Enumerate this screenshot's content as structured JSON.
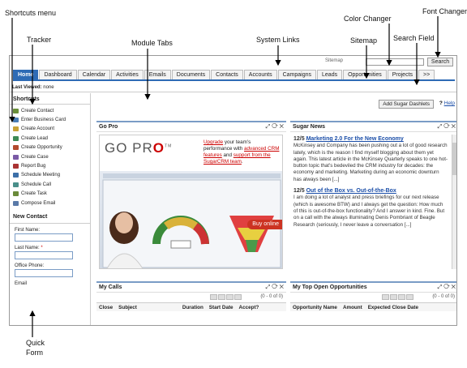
{
  "callouts": {
    "shortcuts_menu": "Shortcuts menu",
    "tracker": "Tracker",
    "module_tabs": "Module Tabs",
    "system_links": "System Links",
    "color_changer": "Color Changer",
    "font_changer": "Font Changer",
    "sitemap": "Sitemap",
    "search_field": "Search Field",
    "quick_form_1": "Quick",
    "quick_form_2": "Form"
  },
  "header": {
    "system_links_text": "Sitemap",
    "search_button": "Search"
  },
  "tabs": [
    {
      "label": "Home",
      "active": true
    },
    {
      "label": "Dashboard"
    },
    {
      "label": "Calendar"
    },
    {
      "label": "Activities"
    },
    {
      "label": "Emails"
    },
    {
      "label": "Documents"
    },
    {
      "label": "Contacts"
    },
    {
      "label": "Accounts"
    },
    {
      "label": "Campaigns"
    },
    {
      "label": "Leads"
    },
    {
      "label": "Opportunities"
    },
    {
      "label": "Projects"
    },
    {
      "label": ">>"
    }
  ],
  "last_viewed": {
    "label": "Last Viewed:",
    "value": "none"
  },
  "sidebar": {
    "shortcuts_title": "Shortcuts",
    "shortcuts": [
      {
        "label": "Create Contact",
        "color": "#6b8f3a"
      },
      {
        "label": "Enter Business Card",
        "color": "#4a7db6"
      },
      {
        "label": "Create Account",
        "color": "#c9a236"
      },
      {
        "label": "Create Lead",
        "color": "#3d8a55"
      },
      {
        "label": "Create Opportunity",
        "color": "#b34a2e"
      },
      {
        "label": "Create Case",
        "color": "#7a5aa6"
      },
      {
        "label": "Report Bug",
        "color": "#a33"
      },
      {
        "label": "Schedule Meeting",
        "color": "#3c6fa8"
      },
      {
        "label": "Schedule Call",
        "color": "#4a8f8a"
      },
      {
        "label": "Create Task",
        "color": "#6a8a3a"
      },
      {
        "label": "Compose Email",
        "color": "#5a7aa8"
      }
    ],
    "quick_form_title": "New Contact",
    "fields": [
      {
        "label": "First Name:"
      },
      {
        "label": "Last Name:",
        "required": "*"
      },
      {
        "label": "Office Phone:"
      },
      {
        "label": "Email"
      }
    ]
  },
  "main": {
    "add_dashlets": "Add Sugar Dashlets",
    "help_q": "?",
    "help": "Help"
  },
  "gopro": {
    "title": "Go Pro",
    "logo_a": "GO PR",
    "logo_b": "O",
    "tm": "TM",
    "text_1": "Upgrade",
    "text_2": " your team's performance with ",
    "text_3": "advanced CRM features",
    "text_4": " and ",
    "text_5": "support from the SugarCRM team",
    "text_6": ".",
    "buy": "Buy online"
  },
  "news": {
    "title": "Sugar News",
    "items": [
      {
        "date": "12/5",
        "headline": "Marketing 2.0 For the New Economy",
        "body": "McKinsey and Company has been pushing out a lot of good research lately, which is the reason I find myself blogging about them yet again. This latest article in the McKinsey Quarterly speaks to one hot-button topic that's bedeviled the CRM industry for decades: the economy and marketing. Marketing during an economic downturn has always been [...]"
      },
      {
        "date": "12/5",
        "headline": "Out of the Box vs. Out-of-the-Box",
        "body": "I am doing a lot of analyst and press briefings for our next release (which is awesome BTW) and I always get the question: How much of this is out-of-the-box functionality? And I answer in kind. Fine. But on a call with the always illuminating Denis Pombriant of Beagle Research (seriously, I never leave a conversation [...]"
      }
    ]
  },
  "my_calls": {
    "title": "My Calls",
    "pager": "(0 - 0 of 0)",
    "columns": [
      "Close",
      "Subject",
      "Duration",
      "Start Date",
      "Accept?"
    ]
  },
  "my_opps": {
    "title": "My Top Open Opportunities",
    "pager": "(0 - 0 of 0)",
    "columns": [
      "Opportunity Name",
      "Amount",
      "Expected Close Date"
    ]
  },
  "dashlet_controls": "⤢ ⟳ ✕"
}
